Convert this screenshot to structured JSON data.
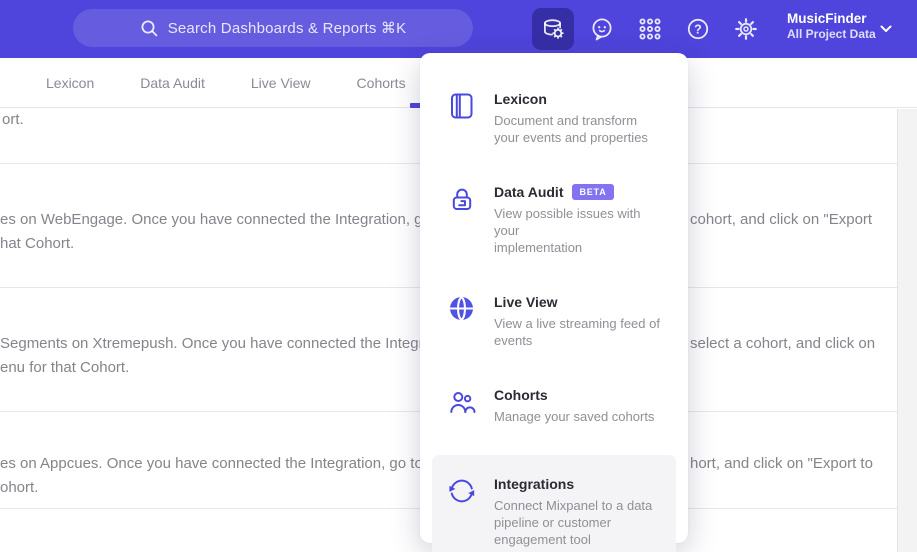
{
  "header": {
    "search_placeholder": "Search Dashboards & Reports ⌘K",
    "project_name": "MusicFinder",
    "project_subtitle": "All Project Data",
    "icons": [
      "search-icon",
      "data-management-icon",
      "feedback-icon",
      "apps-grid-icon",
      "help-icon",
      "settings-icon",
      "chevron-down-icon"
    ]
  },
  "tabs": [
    {
      "label": "Lexicon"
    },
    {
      "label": "Data Audit"
    },
    {
      "label": "Live View"
    },
    {
      "label": "Cohorts"
    }
  ],
  "menu": {
    "items": [
      {
        "title": "Lexicon",
        "icon": "book-icon",
        "description": "Document and transform\nyour events and properties"
      },
      {
        "title": "Data Audit",
        "icon": "audit-lock-icon",
        "badge": "BETA",
        "description": "View possible issues with your\nimplementation"
      },
      {
        "title": "Live View",
        "icon": "globe-icon",
        "description": "View a live streaming feed of\nevents"
      },
      {
        "title": "Cohorts",
        "icon": "people-icon",
        "description": "Manage your saved cohorts"
      },
      {
        "title": "Integrations",
        "icon": "sync-icon",
        "highlighted": true,
        "description": "Connect Mixpanel to a data\npipeline or customer\nengagement tool"
      }
    ]
  },
  "page": {
    "rows": [
      {
        "line1_left": "ort."
      },
      {
        "line1_left": "es on WebEngage. Once you have connected the Integration, go to the",
        "line1_right": "cohort, and click on \"Export",
        "line2_left": "hat Cohort."
      },
      {
        "line1_left": "Segments on Xtremepush. Once you have connected the Integration,",
        "line1_right": "select a cohort, and click on",
        "line2_left": "enu for that Cohort."
      },
      {
        "line1_left": "es on Appcues. Once you have connected the Integration, go to the M",
        "line1_right": "hort, and click on \"Export to",
        "line2_left": "ohort."
      }
    ]
  },
  "colors": {
    "header_purple": "#4F44DB",
    "accent_indigo": "#4A49DF",
    "beta_badge": "#8373F0",
    "highlight_row": "#F4F4F6",
    "title_text": "#2B2B33",
    "description_text": "#8F8F97",
    "page_text": "#84848C",
    "divider": "#E7E7EA",
    "right_strip": "#F3F3F4"
  }
}
